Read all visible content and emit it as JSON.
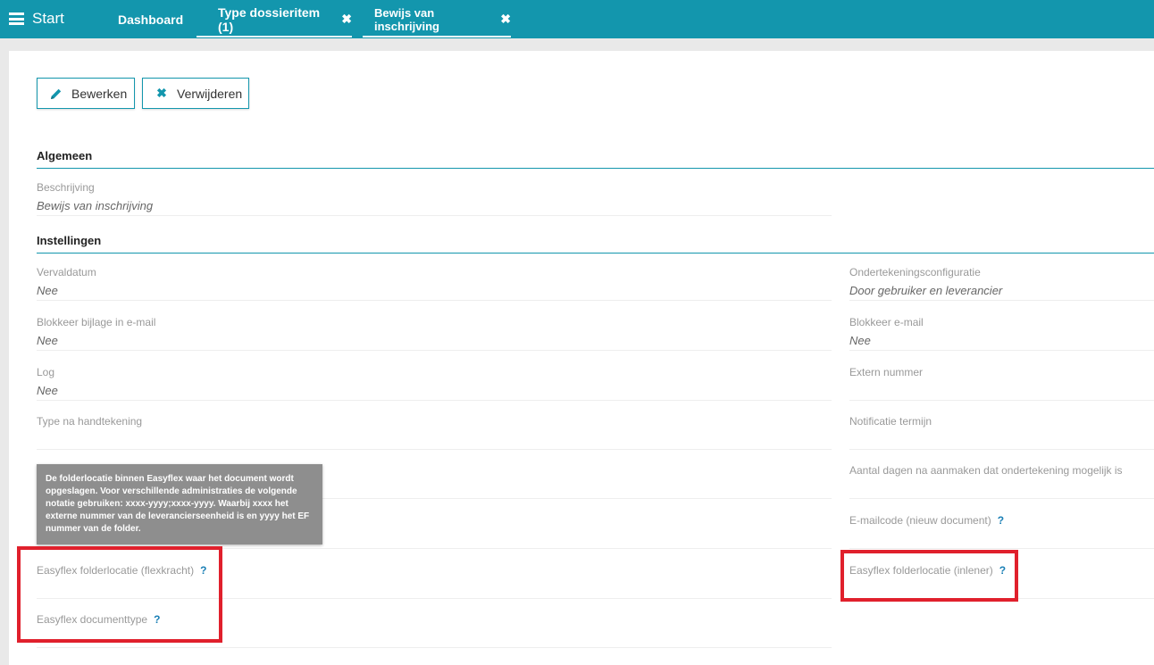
{
  "topbar": {
    "start_label": "Start",
    "tabs": [
      {
        "label": "Dashboard"
      },
      {
        "label": "Type dossieritem (1)"
      },
      {
        "label": "Bewijs van inschrijving"
      }
    ]
  },
  "toolbar": {
    "edit_label": "Bewerken",
    "delete_label": "Verwijderen"
  },
  "sections": {
    "general": "Algemeen",
    "settings": "Instellingen"
  },
  "fields": {
    "beschrijving": {
      "label": "Beschrijving",
      "value": "Bewijs van inschrijving"
    },
    "vervaldatum": {
      "label": "Vervaldatum",
      "value": "Nee"
    },
    "ondertekening": {
      "label": "Ondertekeningsconfiguratie",
      "value": "Door gebruiker en leverancier"
    },
    "blokkeer_bijlage": {
      "label": "Blokkeer bijlage in e-mail",
      "value": "Nee"
    },
    "blokkeer_email": {
      "label": "Blokkeer e-mail",
      "value": "Nee"
    },
    "log": {
      "label": "Log",
      "value": "Nee"
    },
    "extern_nummer": {
      "label": "Extern nummer",
      "value": ""
    },
    "type_na_handtekening": {
      "label": "Type na handtekening",
      "value": ""
    },
    "notificatie_termijn": {
      "label": "Notificatie termijn",
      "value": ""
    },
    "aantal_dagen": {
      "label": "Aantal dagen na aanmaken dat ondertekening mogelijk is",
      "value": ""
    },
    "emailcode": {
      "label": "E-mailcode (nieuw document)",
      "value": ""
    },
    "folder_flexkracht": {
      "label": "Easyflex folderlocatie (flexkracht)",
      "value": ""
    },
    "folder_inlener": {
      "label": "Easyflex folderlocatie (inlener)",
      "value": ""
    },
    "documenttype": {
      "label": "Easyflex documenttype",
      "value": ""
    }
  },
  "help_mark": "?",
  "tooltip": {
    "text": "De folderlocatie binnen Easyflex waar het document wordt opgeslagen. Voor verschillende administraties de volgende notatie gebruiken: xxxx-yyyy;xxxx-yyyy. Waarbij xxxx het externe nummer van de leverancierseenheid is en yyyy het EF nummer van de folder."
  },
  "colors": {
    "accent": "#1396ad",
    "highlight": "#e0202c",
    "tooltip_bg": "#8e8e8e"
  },
  "icons": {
    "menu": "hamburger-icon",
    "close": "close-icon",
    "edit": "pencil-icon",
    "delete": "x-icon"
  }
}
